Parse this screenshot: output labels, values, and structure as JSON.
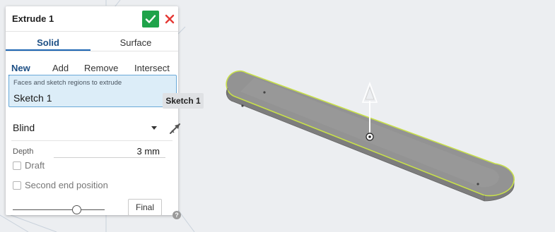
{
  "dialog": {
    "title": "Extrude 1",
    "tabs": [
      {
        "label": "Solid",
        "active": true
      },
      {
        "label": "Surface",
        "active": false
      }
    ],
    "operations": [
      {
        "label": "New",
        "active": true
      },
      {
        "label": "Add",
        "active": false
      },
      {
        "label": "Remove",
        "active": false
      },
      {
        "label": "Intersect",
        "active": false
      }
    ],
    "selection": {
      "label": "Faces and sketch regions to extrude",
      "value": "Sketch 1",
      "tooltip": "Sketch 1"
    },
    "end_type": "Blind",
    "depth": {
      "label": "Depth",
      "value": "3 mm"
    },
    "options": [
      {
        "label": "Draft",
        "checked": false
      },
      {
        "label": "Second end position",
        "checked": false
      }
    ],
    "slider_level": 0.68,
    "final_label": "Final",
    "help_label": "?"
  },
  "colors": {
    "accept": "#1fa34a",
    "cancel": "#e53935",
    "active_tab": "#1d4f85",
    "selection_bg": "#dcedf8",
    "body": "#8e8e8e",
    "outline_highlight": "#c8e04a",
    "viewport_bg": "#eceef1"
  },
  "icons": {
    "accept": "check-icon",
    "cancel": "close-icon",
    "flip": "flip-direction-icon",
    "manipulator": "arrow-manipulator-icon",
    "help": "help-icon"
  }
}
